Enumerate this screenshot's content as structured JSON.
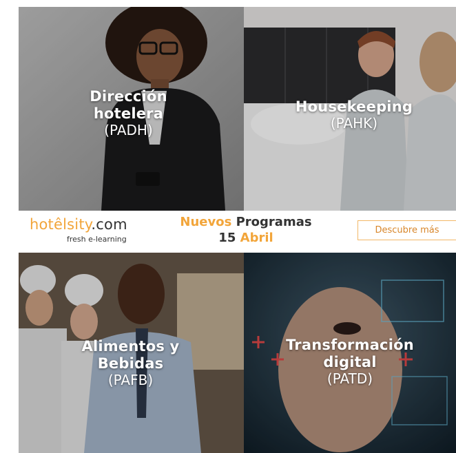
{
  "tiles": {
    "direccion": {
      "title_line1": "Dirección",
      "title_line2": "hotelera",
      "code": "(PADH)"
    },
    "housekeeping": {
      "title_line1": "Housekeeping",
      "code": "(PAHK)"
    },
    "alimentos": {
      "title_line1": "Alimentos y",
      "title_line2": "Bebidas",
      "code": "(PAFB)"
    },
    "transformacion": {
      "title_line1": "Transformación",
      "title_line2": "digital",
      "code": "(PATD)"
    }
  },
  "band": {
    "logo_hotel": "hotêl",
    "logo_sity": "sity",
    "logo_com": ".com",
    "tagline": "fresh e-learning",
    "headline_word1": "Nuevos",
    "headline_word2": "Programas",
    "date_day": "15",
    "date_month": "Abril",
    "cta_label": "Descubre más"
  },
  "colors": {
    "accent": "#f2a53a",
    "text_dark": "#333333"
  }
}
